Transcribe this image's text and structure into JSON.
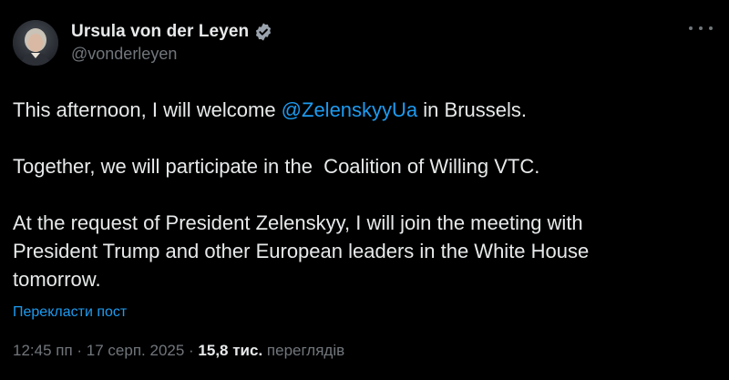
{
  "author": {
    "display_name": "Ursula von der Leyen",
    "handle": "@vonderleyen",
    "verified": true
  },
  "more_icon": "more-horizontal-icon",
  "tweet": {
    "line1_before": "This afternoon, I will welcome ",
    "line1_mention": "@ZelenskyyUa",
    "line1_after": " in Brussels.",
    "paragraph2": "Together, we will participate in the  Coalition of Willing VTC.",
    "paragraph3_line1": "At the request of President Zelenskyy, I will join the meeting with",
    "paragraph3_line2": "President Trump and other European leaders in the White House",
    "paragraph3_line3": "tomorrow."
  },
  "translate_label": "Перекласти пост",
  "meta": {
    "time": "12:45 пп",
    "separator": " · ",
    "date": "17 серп. 2025",
    "separator2": " · ",
    "views_count": "15,8 тис.",
    "views_label": " переглядів"
  },
  "colors": {
    "background": "#000000",
    "text": "#e7e9ea",
    "secondary": "#71767b",
    "accent": "#1d9bf0"
  }
}
